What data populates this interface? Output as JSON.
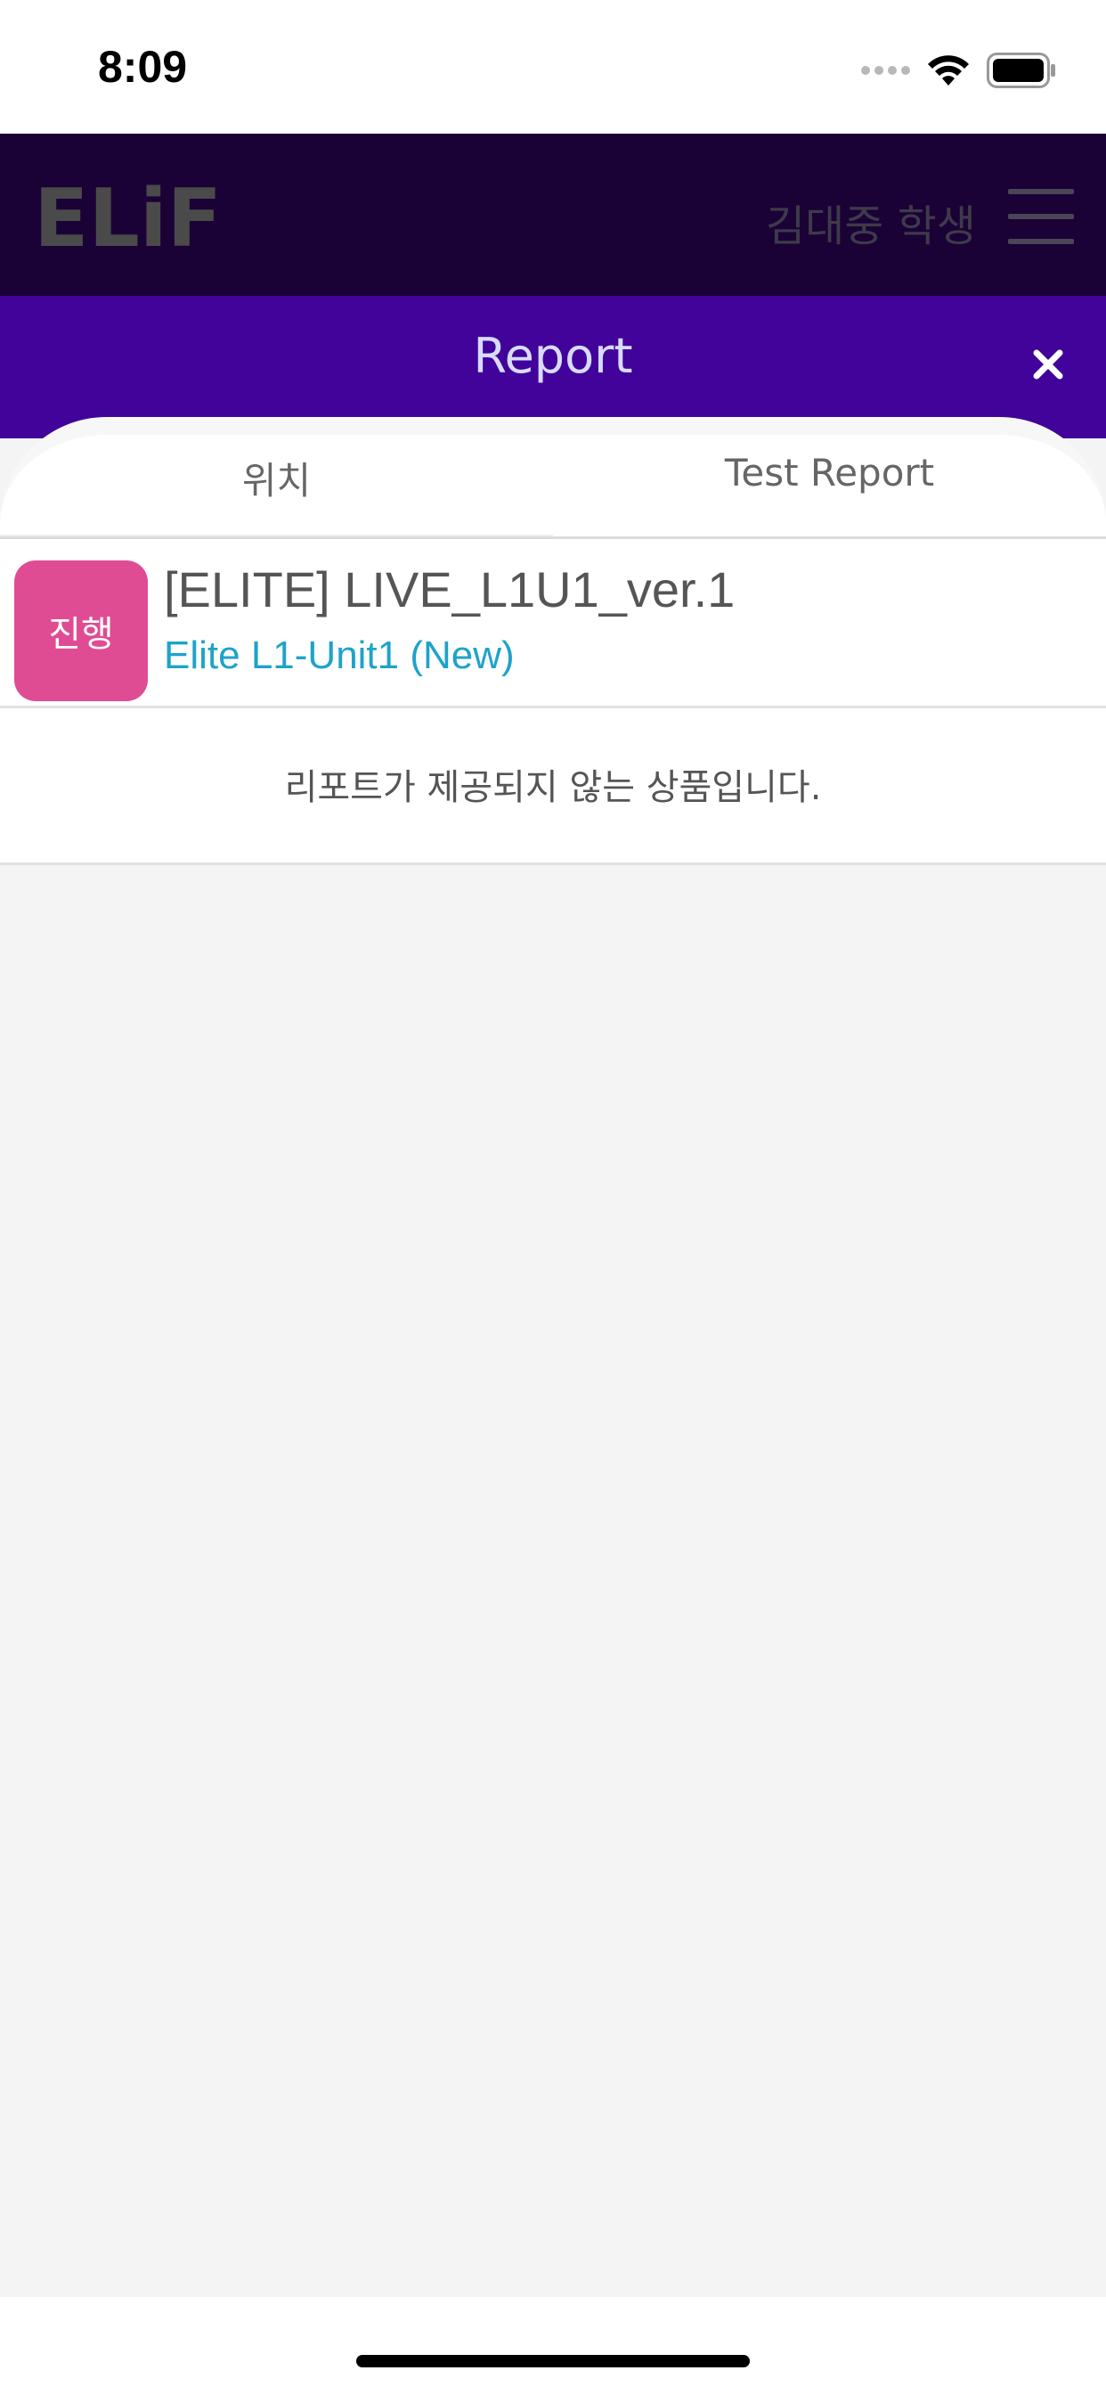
{
  "status_bar": {
    "time": "8:09"
  },
  "header": {
    "logo_text": "ELiF",
    "user_name": "김대중 학생"
  },
  "report_bar": {
    "title": "Report"
  },
  "tabs": [
    {
      "label": "위치"
    },
    {
      "label": "Test Report"
    }
  ],
  "course": {
    "status": "진행",
    "title": "[ELITE] LIVE_L1U1_ver.1",
    "subtitle": "Elite L1-Unit1 (New)"
  },
  "notice": "리포트가 제공되지 않는 상품입니다.",
  "colors": {
    "header_bg": "#1a0236",
    "report_bar_bg": "#42039a",
    "badge": "#e04c94",
    "subtitle": "#1ea3c9"
  },
  "icons": [
    "signal-icon",
    "wifi-icon",
    "battery-icon",
    "menu-icon",
    "close-icon"
  ]
}
